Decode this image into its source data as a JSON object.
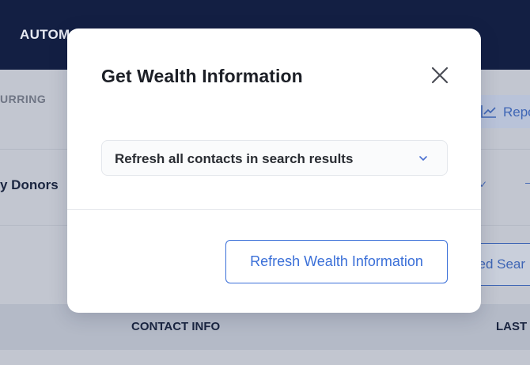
{
  "background": {
    "topbar_title": "AUTOM",
    "tab_label": "URRING",
    "reports_label": "Repo",
    "segment_label": "y Donors",
    "check_glyph": "✓",
    "dash_glyph": "–",
    "advanced_search_label": "ced Sear",
    "table_columns": [
      "CONTACT INFO",
      "LAST"
    ]
  },
  "modal": {
    "title": "Get Wealth Information",
    "close_icon": "close-icon",
    "select": {
      "value": "Refresh all contacts in search results",
      "icon": "chevron-down-icon"
    },
    "primary_button_label": "Refresh Wealth Information"
  },
  "colors": {
    "topbar": "#131f43",
    "accent": "#3a6fd8",
    "overlay": "#c2c6d0"
  }
}
